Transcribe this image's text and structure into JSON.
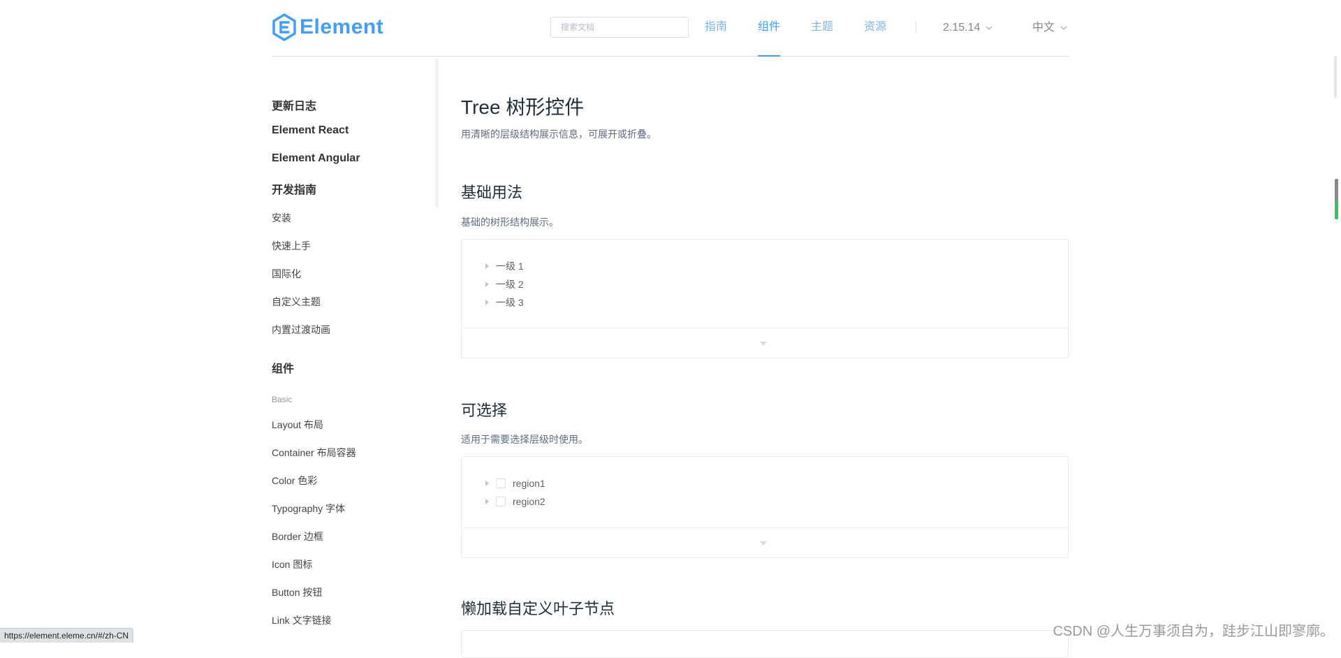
{
  "header": {
    "logo_text": "Element",
    "search_placeholder": "搜索文档",
    "nav": [
      "指南",
      "组件",
      "主题",
      "资源"
    ],
    "active_nav": "组件",
    "version": "2.15.14",
    "language": "中文"
  },
  "sidebar": {
    "top_links": [
      "更新日志",
      "Element React",
      "Element Angular"
    ],
    "guide_heading": "开发指南",
    "guide_items": [
      "安装",
      "快速上手",
      "国际化",
      "自定义主题",
      "内置过渡动画"
    ],
    "components_heading": "组件",
    "group_label": "Basic",
    "basic_items": [
      "Layout 布局",
      "Container 布局容器",
      "Color 色彩",
      "Typography 字体",
      "Border 边框",
      "Icon 图标",
      "Button 按钮",
      "Link 文字链接"
    ]
  },
  "main": {
    "title": "Tree 树形控件",
    "intro": "用清晰的层级结构展示信息，可展开或折叠。",
    "sections": [
      {
        "title": "基础用法",
        "desc": "基础的树形结构展示。",
        "nodes": [
          "一级 1",
          "一级 2",
          "一级 3"
        ]
      },
      {
        "title": "可选择",
        "desc": "适用于需要选择层级时使用。",
        "nodes": [
          "region1",
          "region2"
        ]
      },
      {
        "title": "懒加载自定义叶子节点"
      }
    ]
  },
  "status_url": "https://element.eleme.cn/#/zh-CN",
  "watermark": "CSDN @人生万事须自为，跬步江山即寥廓。",
  "colors": {
    "accent": "#409eff",
    "nav_inactive": "#7eb6ef",
    "heading": "#1f2f3d",
    "text": "#606266"
  }
}
